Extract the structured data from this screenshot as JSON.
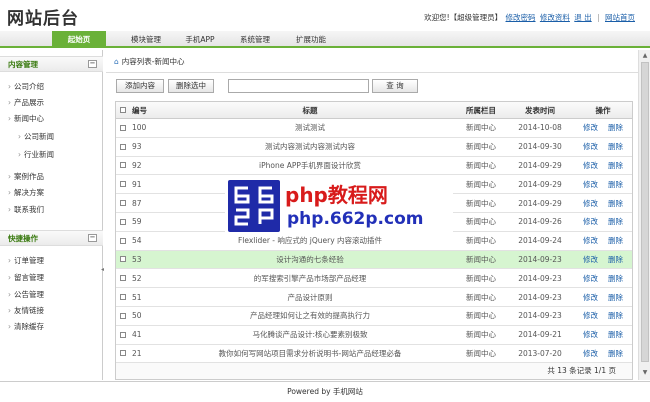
{
  "header": {
    "logo": "网站后台",
    "welcome": "欢迎您!【超级管理员】",
    "links": [
      "修改密码",
      "修改资料",
      "退 出",
      "网站首页"
    ]
  },
  "nav": {
    "items": [
      "起始页",
      "模块管理",
      "手机APP",
      "系统管理",
      "扩展功能"
    ],
    "active_index": 0
  },
  "sidebar": {
    "section1": {
      "title": "内容管理",
      "items": [
        "公司介绍",
        "产品展示",
        "新闻中心",
        "公司新闻",
        "行业新闻",
        "案例作品",
        "解决方案",
        "联系我们"
      ]
    },
    "section2": {
      "title": "快捷操作",
      "items": [
        "订单管理",
        "留言管理",
        "公告管理",
        "友情链接",
        "清除缓存"
      ]
    }
  },
  "main": {
    "breadcrumb": "内容列表-新闻中心",
    "toolbar": {
      "add_label": "添加内容",
      "delete_label": "删除选中",
      "search_value": "",
      "search_label": "查 询"
    },
    "table": {
      "headers": [
        "编号",
        "标题",
        "所属栏目",
        "发表时间",
        "操作"
      ],
      "op_edit": "修改",
      "op_delete": "删除",
      "rows": [
        {
          "id": "100",
          "title": "测试测试",
          "category": "新闻中心",
          "date": "2014-10-08"
        },
        {
          "id": "93",
          "title": "测试内容测试内容测试内容",
          "category": "新闻中心",
          "date": "2014-09-30"
        },
        {
          "id": "92",
          "title": "iPhone APP手机界面设计欣赏",
          "category": "新闻中心",
          "date": "2014-09-29"
        },
        {
          "id": "91",
          "title": "",
          "category": "新闻中心",
          "date": "2014-09-29"
        },
        {
          "id": "87",
          "title": "",
          "category": "新闻中心",
          "date": "2014-09-29"
        },
        {
          "id": "59",
          "title": "",
          "category": "新闻中心",
          "date": "2014-09-26"
        },
        {
          "id": "54",
          "title": "Flexlider - 响应式的 jQuery 内容滚动插件",
          "category": "新闻中心",
          "date": "2014-09-24"
        },
        {
          "id": "53",
          "title": "设计沟通的七条经验",
          "category": "新闻中心",
          "date": "2014-09-23"
        },
        {
          "id": "52",
          "title": "的军搜索引擎产品市场部产品经理",
          "category": "新闻中心",
          "date": "2014-09-23"
        },
        {
          "id": "51",
          "title": "产品设计原则",
          "category": "新闻中心",
          "date": "2014-09-23"
        },
        {
          "id": "50",
          "title": "产品经理如何让之有效的提高执行力",
          "category": "新闻中心",
          "date": "2014-09-23"
        },
        {
          "id": "41",
          "title": "马化腾谈产品设计:核心要素别极致",
          "category": "新闻中心",
          "date": "2014-09-21"
        },
        {
          "id": "21",
          "title": "教你如何写网站项目需求分析说明书-网站产品经理必备",
          "category": "新闻中心",
          "date": "2013-07-20"
        }
      ],
      "highlight_index": 7,
      "page_info": "共 13 条记录 1/1 页"
    }
  },
  "footer": {
    "text": "Powered by 手机网站"
  },
  "watermark": {
    "title": "php教程网",
    "url": "php.662p.com"
  }
}
